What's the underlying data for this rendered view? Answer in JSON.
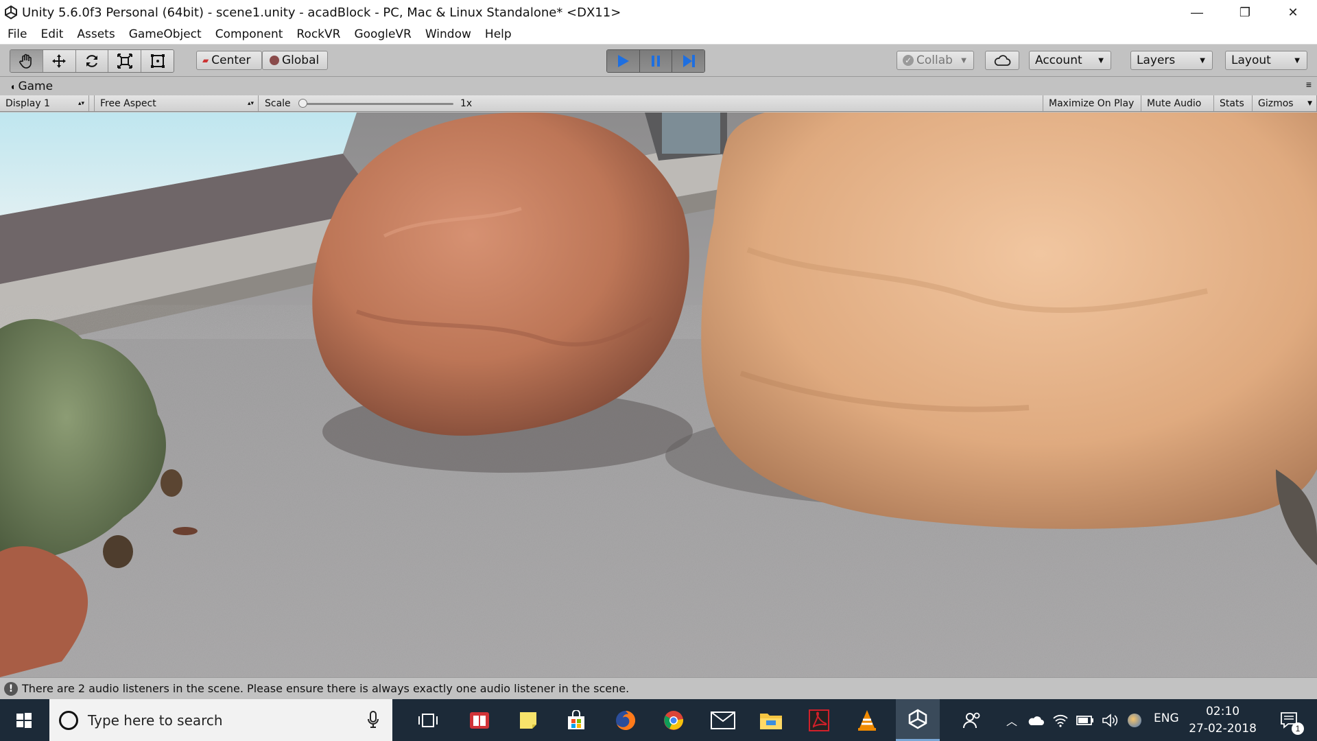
{
  "window": {
    "title": "Unity 5.6.0f3 Personal (64bit) - scene1.unity - acadBlock - PC, Mac & Linux Standalone* <DX11>",
    "minimize": "—",
    "maximize": "❐",
    "close": "✕"
  },
  "menu": [
    "File",
    "Edit",
    "Assets",
    "GameObject",
    "Component",
    "RockVR",
    "GoogleVR",
    "Window",
    "Help"
  ],
  "toolbar": {
    "pivot_label": "Center",
    "space_label": "Global",
    "collab_label": "Collab",
    "account_label": "Account",
    "layers_label": "Layers",
    "layout_label": "Layout"
  },
  "game_tab": {
    "label": "Game",
    "display": "Display 1",
    "aspect": "Free Aspect",
    "scale_label": "Scale",
    "scale_value": "1x",
    "maximize_on_play": "Maximize On Play",
    "mute_audio": "Mute Audio",
    "stats": "Stats",
    "gizmos": "Gizmos"
  },
  "status": {
    "message": "There are 2 audio listeners in the scene. Please ensure there is always exactly one audio listener in the scene."
  },
  "taskbar": {
    "search_placeholder": "Type here to search",
    "language": "ENG",
    "time": "02:10",
    "date": "27-02-2018",
    "notification_count": "1"
  },
  "colors": {
    "taskbar": "#1c2a38",
    "editor_gray": "#c2c2c2",
    "play_blue": "#1e6fe0"
  }
}
